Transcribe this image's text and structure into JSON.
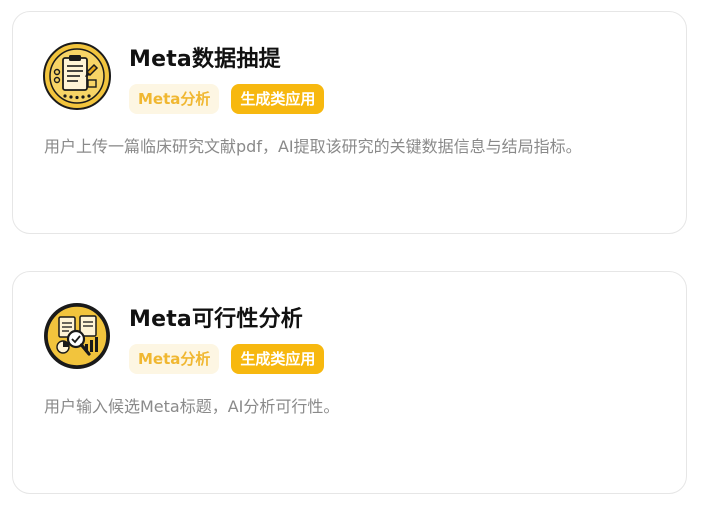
{
  "cards": [
    {
      "title": "Meta数据抽提",
      "tags": [
        "Meta分析",
        "生成类应用"
      ],
      "description": "用户上传一篇临床研究文献pdf，AI提取该研究的关键数据信息与结局指标。",
      "icon": "document-extraction-icon"
    },
    {
      "title": "Meta可行性分析",
      "tags": [
        "Meta分析",
        "生成类应用"
      ],
      "description": "用户输入候选Meta标题，AI分析可行性。",
      "icon": "feasibility-analysis-icon"
    }
  ],
  "colors": {
    "accent": "#f7b80f",
    "tag_light_bg": "#fdf6e3",
    "tag_light_text": "#f0b731",
    "description": "#8a8a8a",
    "title": "#111111",
    "card_border": "#e6e6e6"
  }
}
